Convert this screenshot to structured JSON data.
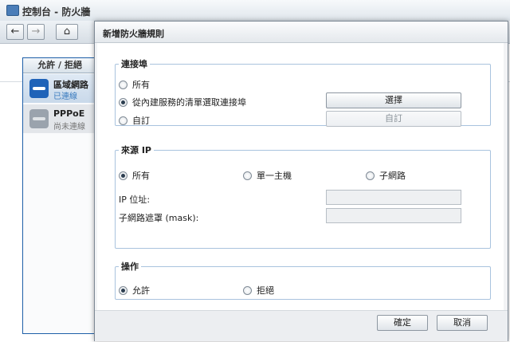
{
  "window": {
    "title": "控制台 - 防火牆"
  },
  "toolbar": {
    "back": "←",
    "forward": "→",
    "home": "⌂"
  },
  "panel": {
    "tab_label": "允許 / 拒絕",
    "interfaces": [
      {
        "name": "區域網路",
        "status": "已連線",
        "icon": "network-connected-icon"
      },
      {
        "name": "PPPoE",
        "status": "尚未連線",
        "icon": "network-disconnected-icon"
      }
    ]
  },
  "dialog": {
    "title": "新增防火牆規則",
    "ports": {
      "legend": "連接埠",
      "options": [
        "所有",
        "從內建服務的清單選取連接埠",
        "自訂"
      ],
      "selected": 1,
      "select_button": "選擇",
      "custom_button": "自訂"
    },
    "source_ip": {
      "legend": "來源 IP",
      "options": [
        "所有",
        "單一主機",
        "子網路"
      ],
      "selected": 0,
      "ip_label": "IP 位址:",
      "ip_value": "",
      "mask_label": "子網路遮罩 (mask):",
      "mask_value": ""
    },
    "action": {
      "legend": "操作",
      "options": [
        "允許",
        "拒絕"
      ],
      "selected": 0
    },
    "ok_button": "確定",
    "cancel_button": "取消"
  }
}
